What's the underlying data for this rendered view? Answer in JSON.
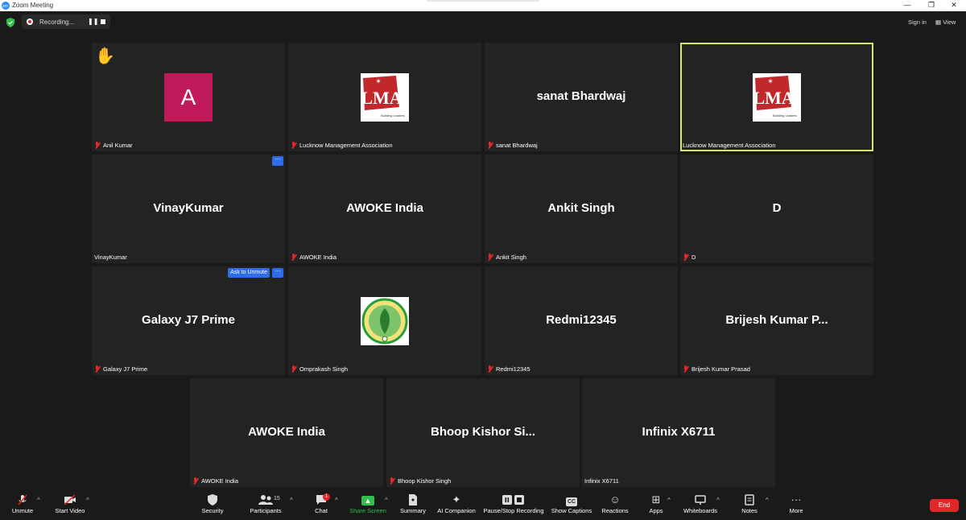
{
  "window": {
    "title": "Zoom Meeting",
    "minimize": "—",
    "restore": "❐",
    "close": "✕"
  },
  "topbar": {
    "recording_text": "Recording...",
    "pause_symbol": "❚❚",
    "signin": "Sign in",
    "view": "View",
    "view_icon": "▦"
  },
  "tiles": [
    {
      "label": "Anil Kumar",
      "avatar_letter": "A",
      "avatar_color": "#c11a5a",
      "hand_raised": true
    },
    {
      "label": "Lucknow Management Association",
      "logo_text": "LMA",
      "logo_sub": "Building Leaders"
    },
    {
      "label": "sanat Bhardwaj",
      "big": "sanat Bhardwaj"
    },
    {
      "label": "Lucknow Management Association",
      "logo_text": "LMA",
      "logo_sub": "Building Leaders",
      "active_speaker": true
    },
    {
      "label": "VinayKumar",
      "big": "VinayKumar",
      "more": "···"
    },
    {
      "label": "AWOKE India",
      "big": "AWOKE India"
    },
    {
      "label": "Ankit Singh",
      "big": "Ankit Singh"
    },
    {
      "label": "D",
      "big": "D"
    },
    {
      "label": "Galaxy J7 Prime",
      "big": "Galaxy J7 Prime",
      "ask_unmute": "Ask to Unmute",
      "more": "···"
    },
    {
      "label": "Omprakash Singh"
    },
    {
      "label": "Redmi12345",
      "big": "Redmi12345"
    },
    {
      "label": "Brijesh Kumar Prasad",
      "big": "Brijesh  Kumar  P..."
    },
    {
      "label": "AWOKE India",
      "big": "AWOKE India"
    },
    {
      "label": "Bhoop Kishor Singh",
      "big": "Bhoop  Kishor  Si..."
    },
    {
      "label": "Infinix X6711",
      "big": "Infinix X6711"
    }
  ],
  "toolbar": {
    "unmute": "Unmute",
    "start_video": "Start Video",
    "security": "Security",
    "participants": "Participants",
    "participants_count": "15",
    "chat": "Chat",
    "chat_badge": "1",
    "share_screen": "Share Screen",
    "summary": "Summary",
    "ai_companion": "AI Companion",
    "pause_stop_recording": "Pause/Stop Recording",
    "show_captions": "Show Captions",
    "cc": "CC",
    "reactions": "Reactions",
    "apps": "Apps",
    "whiteboards": "Whiteboards",
    "notes": "Notes",
    "more": "More",
    "end": "End"
  },
  "colors": {
    "accent_green": "#2fbf4a",
    "end_red": "#e02828",
    "active_border": "#d8e86a",
    "button_blue": "#2d6ee8"
  }
}
